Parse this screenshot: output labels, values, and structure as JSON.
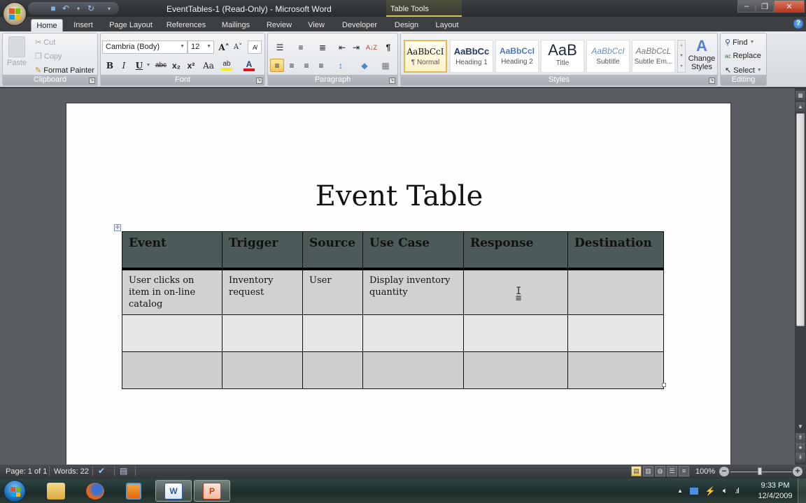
{
  "window": {
    "title": "EventTables-1 (Read-Only) - Microsoft Word",
    "contextual_tab_group": "Table Tools",
    "controls": {
      "minimize": "–",
      "restore": "❐",
      "close": "✕"
    }
  },
  "quick_access": {
    "save_icon": "💾",
    "undo_icon": "↶",
    "undo_dropdown": "▾",
    "redo_icon": "↻",
    "customize_icon": "▾"
  },
  "tabs": [
    {
      "label": "Home",
      "active": true
    },
    {
      "label": "Insert"
    },
    {
      "label": "Page Layout"
    },
    {
      "label": "References"
    },
    {
      "label": "Mailings"
    },
    {
      "label": "Review"
    },
    {
      "label": "View"
    },
    {
      "label": "Developer"
    },
    {
      "label": "Design"
    },
    {
      "label": "Layout"
    }
  ],
  "help_icon": "?",
  "ribbon": {
    "clipboard": {
      "label": "Clipboard",
      "paste": "Paste",
      "cut": "Cut",
      "copy": "Copy",
      "format_painter": "Format Painter"
    },
    "font": {
      "label": "Font",
      "font_name": "Cambria (Body)",
      "font_size": "12",
      "grow": "A˄",
      "shrink": "A˅",
      "clear": "A̸",
      "bold": "B",
      "italic": "I",
      "underline": "U",
      "strike": "abc",
      "subscript": "x₂",
      "superscript": "x²",
      "change_case": "Aa",
      "highlight": "ab",
      "font_color": "A",
      "highlight_color": "#f6ea2a",
      "font_color_value": "#e0141a"
    },
    "paragraph": {
      "label": "Paragraph",
      "bullets": "☰",
      "numbering": "≡",
      "multilevel": "≣",
      "decrease_indent": "⇤",
      "increase_indent": "⇥",
      "sort": "A↓Z",
      "show_marks": "¶",
      "align_left": "≡",
      "center": "≡",
      "align_right": "≡",
      "justify": "≡",
      "line_spacing": "↕",
      "shading": "◆",
      "borders": "▦"
    },
    "styles": {
      "label": "Styles",
      "items": [
        {
          "sample": "AaBbCcI",
          "name": "¶ Normal",
          "selected": true
        },
        {
          "sample": "AaBbCc",
          "name": "Heading 1"
        },
        {
          "sample": "AaBbCcI",
          "name": "Heading 2"
        },
        {
          "sample": "AaB",
          "name": "Title"
        },
        {
          "sample": "AaBbCcI",
          "name": "Subtitle"
        },
        {
          "sample": "AaBbCcL",
          "name": "Subtle Em..."
        }
      ],
      "change_styles": "Change Styles"
    },
    "editing": {
      "label": "Editing",
      "find": "Find",
      "replace": "Replace",
      "select": "Select"
    }
  },
  "document": {
    "title": "Event Table",
    "table": {
      "headers": [
        "Event",
        "Trigger",
        "Source",
        "Use Case",
        "Response",
        "Destination"
      ],
      "rows": [
        [
          "User clicks on item in on-line catalog",
          "Inventory request",
          "User",
          "Display inventory quantity",
          "",
          ""
        ],
        [
          "",
          "",
          "",
          "",
          "",
          ""
        ],
        [
          "",
          "",
          "",
          "",
          "",
          ""
        ]
      ],
      "header_color": "#4d5a5a"
    }
  },
  "statusbar": {
    "page": "Page: 1 of 1",
    "words": "Words: 22",
    "zoom": "100%",
    "zoom_value_percent": 100
  },
  "taskbar": {
    "apps": [
      {
        "name": "Windows Explorer"
      },
      {
        "name": "Firefox"
      },
      {
        "name": "Windows Media Player"
      },
      {
        "name": "Microsoft Word",
        "active": true
      },
      {
        "name": "PowerPoint",
        "active": true
      }
    ],
    "time": "9:33 PM",
    "date": "12/4/2009",
    "tray_expand": "▲"
  }
}
